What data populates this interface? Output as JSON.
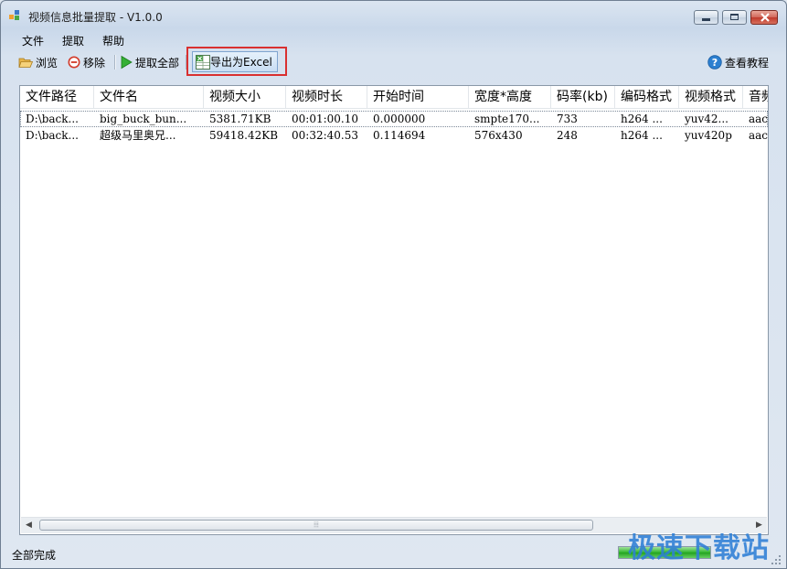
{
  "window": {
    "title": "视频信息批量提取 - V1.0.0"
  },
  "menu": {
    "items": [
      "文件",
      "提取",
      "帮助"
    ]
  },
  "toolbar": {
    "browse_label": "浏览",
    "remove_label": "移除",
    "extract_all_label": "提取全部",
    "export_label": "导出为Excel",
    "tutorial_label": "查看教程"
  },
  "table": {
    "columns": [
      "文件路径",
      "文件名",
      "视频大小",
      "视频时长",
      "开始时间",
      "宽度*高度",
      "码率(kb)",
      "编码格式",
      "视频格式",
      "音频"
    ],
    "rows": [
      [
        "D:\\back...",
        "big_buck_bun...",
        "5381.71KB",
        "00:01:00.10",
        "0.000000",
        "smpte170...",
        "733",
        "h264 ...",
        "yuv42...",
        "aac"
      ],
      [
        "D:\\back...",
        "超级马里奥兄...",
        "59418.42KB",
        "00:32:40.53",
        "0.114694",
        "576x430",
        "248",
        "h264 ...",
        "yuv420p",
        "aac"
      ]
    ]
  },
  "status": {
    "text": "全部完成",
    "progress_fraction": 1.0
  },
  "watermark": {
    "text": "极速下载站"
  },
  "colors": {
    "highlight_border": "#d93030",
    "progress": "#2fb52c",
    "watermark": "#2e7fd6"
  },
  "icons": [
    "app-icon",
    "folder-open-icon",
    "remove-icon",
    "play-icon",
    "excel-icon",
    "help-icon"
  ]
}
